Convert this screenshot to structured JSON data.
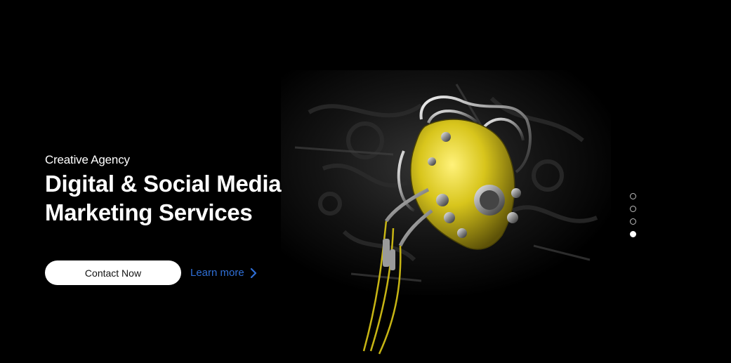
{
  "hero": {
    "eyebrow": "Creative Agency",
    "headline": "Digital & Social Media Marketing Services",
    "contact_label": "Contact Now",
    "learn_more_label": "Learn more"
  },
  "slider": {
    "count": 4,
    "active_index": 4
  },
  "icons": {
    "learn_more": "chevron-right-icon",
    "artwork": "mechanical-heart-image"
  },
  "colors": {
    "background": "#000000",
    "link": "#2f6fd6",
    "heart_accent": "#d8c51c"
  }
}
